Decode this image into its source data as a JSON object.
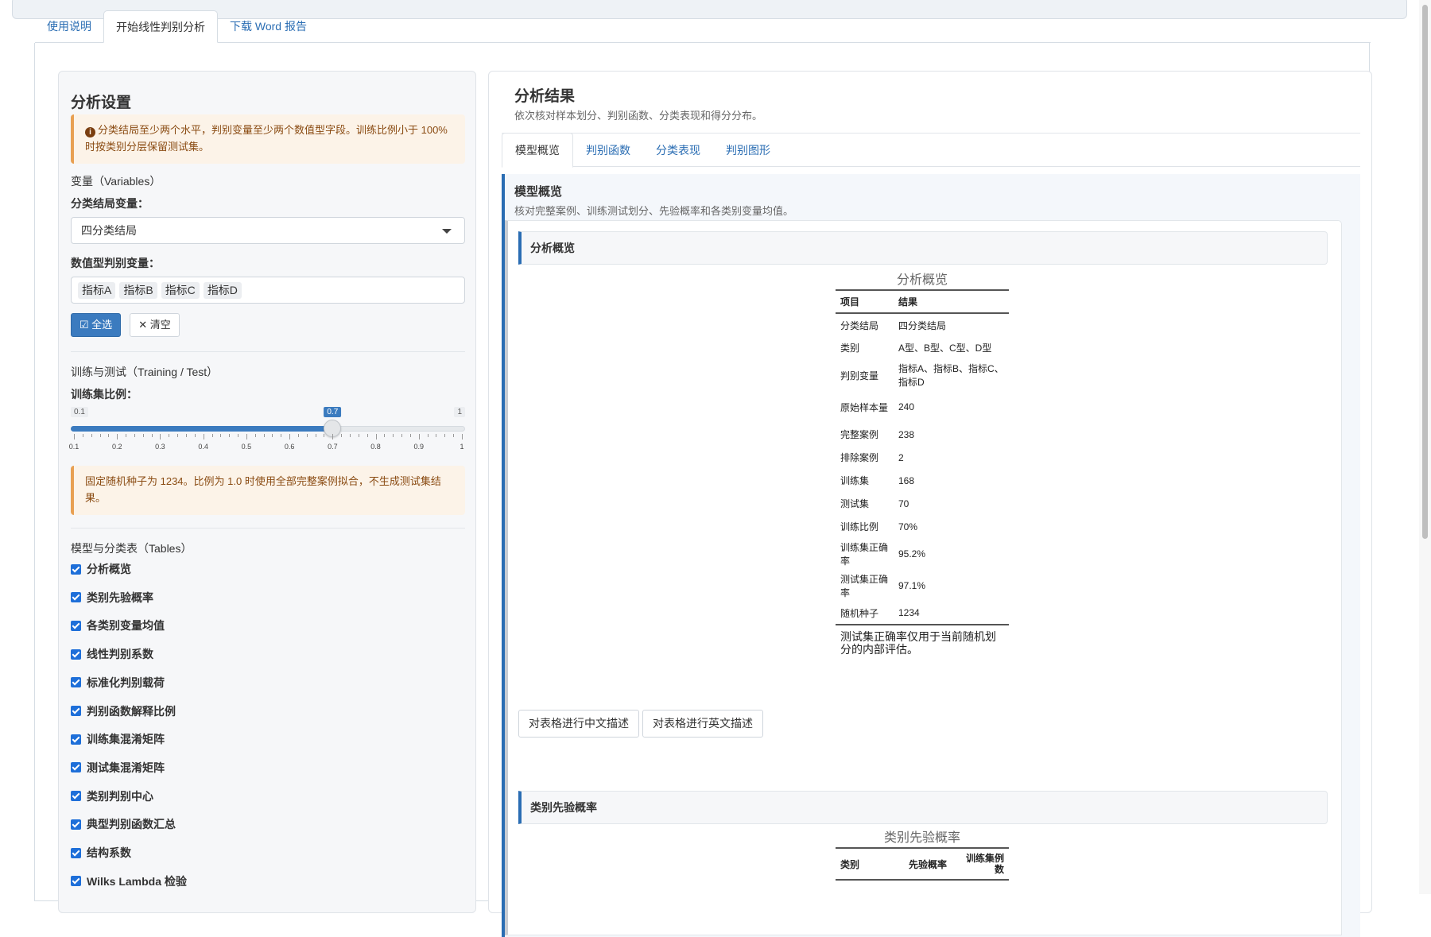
{
  "top_tabs": [
    {
      "label": "使用说明"
    },
    {
      "label": "开始线性判别分析"
    },
    {
      "label": "下载 Word 报告"
    }
  ],
  "sidebar": {
    "title": "分析设置",
    "warning1": "分类结局至少两个水平，判别变量至少两个数值型字段。训练比例小于 100% 时按类别分层保留测试集。",
    "variables_section": "变量（Variables）",
    "outcome_label": "分类结局变量：",
    "outcome_value": "四分类结局",
    "predictors_label": "数值型判别变量：",
    "predictors": [
      "指标A",
      "指标B",
      "指标C",
      "指标D"
    ],
    "select_all": "全选",
    "clear": "清空",
    "train_section": "训练与测试（Training / Test）",
    "train_ratio_label": "训练集比例：",
    "slider": {
      "min": 0.1,
      "max": 1,
      "value": 0.7,
      "min_label": "0.1",
      "max_label": "1",
      "value_label": "0.7",
      "ticks": [
        "0.1",
        "0.2",
        "0.3",
        "0.4",
        "0.5",
        "0.6",
        "0.7",
        "0.8",
        "0.9",
        "1"
      ]
    },
    "warning2": "固定随机种子为 1234。比例为 1.0 时使用全部完整案例拟合，不生成测试集结果。",
    "tables_section": "模型与分类表（Tables）",
    "checkboxes": [
      {
        "label": "分析概览",
        "checked": true
      },
      {
        "label": "类别先验概率",
        "checked": true
      },
      {
        "label": "各类别变量均值",
        "checked": true
      },
      {
        "label": "线性判别系数",
        "checked": true
      },
      {
        "label": "标准化判别载荷",
        "checked": true
      },
      {
        "label": "判别函数解释比例",
        "checked": true
      },
      {
        "label": "训练集混淆矩阵",
        "checked": true
      },
      {
        "label": "测试集混淆矩阵",
        "checked": true
      },
      {
        "label": "类别判别中心",
        "checked": true
      },
      {
        "label": "典型判别函数汇总",
        "checked": true
      },
      {
        "label": "结构系数",
        "checked": true
      },
      {
        "label": "Wilks Lambda 检验",
        "checked": true
      }
    ]
  },
  "main": {
    "title": "分析结果",
    "subtitle": "依次核对样本划分、判别函数、分类表现和得分分布。",
    "tabs": [
      {
        "label": "模型概览"
      },
      {
        "label": "判别函数"
      },
      {
        "label": "分类表现"
      },
      {
        "label": "判别图形"
      }
    ],
    "section_title": "模型概览",
    "section_desc": "核对完整案例、训练测试划分、先验概率和各类别变量均值。",
    "overview": {
      "card_title": "分析概览",
      "caption": "分析概览",
      "headers": [
        "项目",
        "结果"
      ],
      "rows": [
        {
          "k": "分类结局",
          "v": "四分类结局"
        },
        {
          "k": "类别",
          "v": "A型、B型、C型、D型"
        },
        {
          "k": "判别变量",
          "v": "指标A、指标B、指标C、指标D"
        },
        {
          "k": "原始样本量",
          "v": "240"
        },
        {
          "k": "完整案例",
          "v": "238"
        },
        {
          "k": "排除案例",
          "v": "2"
        },
        {
          "k": "训练集",
          "v": "168"
        },
        {
          "k": "测试集",
          "v": "70"
        },
        {
          "k": "训练比例",
          "v": "70%"
        },
        {
          "k": "训练集正确率",
          "v": "95.2%"
        },
        {
          "k": "测试集正确率",
          "v": "97.1%"
        },
        {
          "k": "随机种子",
          "v": "1234"
        }
      ],
      "note": "测试集正确率仅用于当前随机划分的内部评估。",
      "btn_cn": "对表格进行中文描述",
      "btn_en": "对表格进行英文描述"
    },
    "prior": {
      "card_title": "类别先验概率",
      "caption": "类别先验概率",
      "headers": [
        "类别",
        "先验概率",
        "训练集例数"
      ]
    }
  },
  "colors": {
    "accent": "#2a6db3",
    "primary_button": "#3b7bbf",
    "warning_bg": "#fcf3e8",
    "warning_border": "#e8a052",
    "checkbox": "#1e6fd9"
  }
}
